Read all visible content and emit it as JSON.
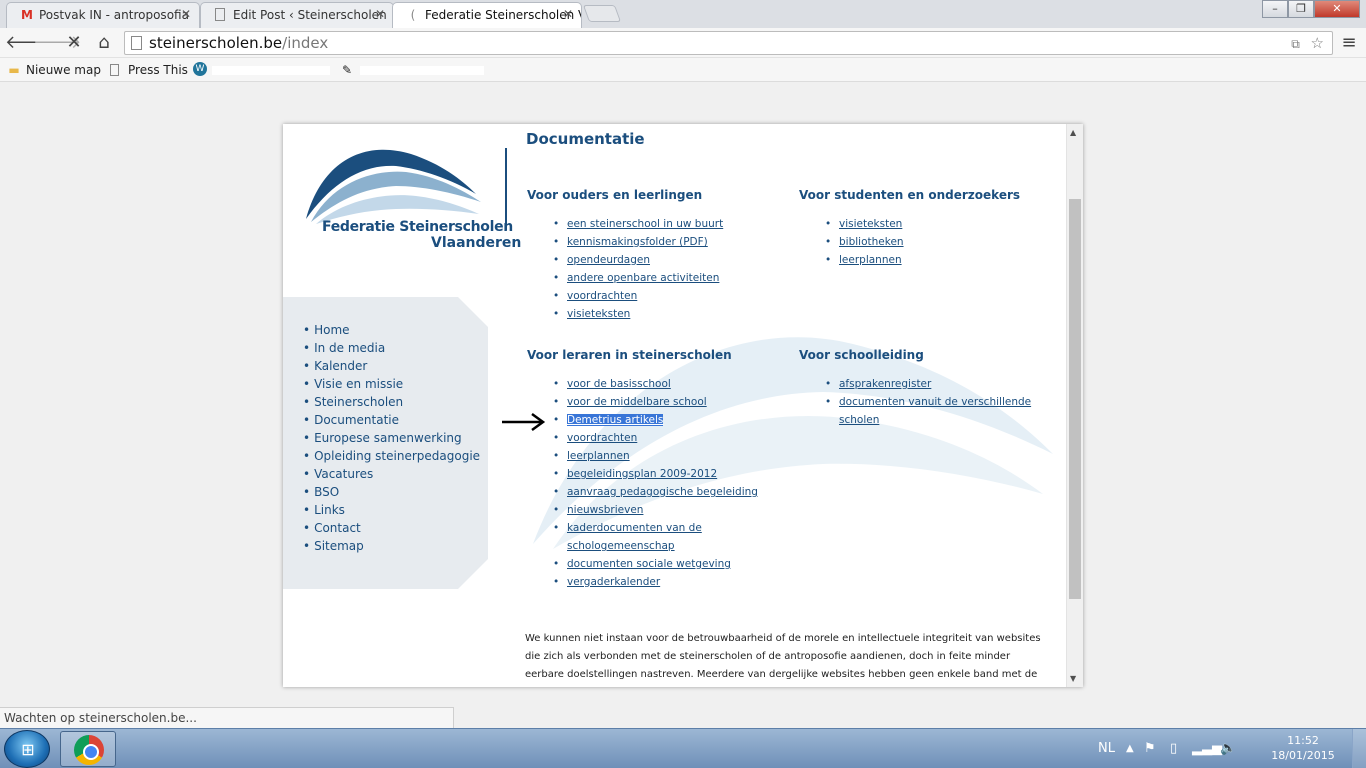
{
  "browser": {
    "tabs": [
      {
        "title": "Postvak IN - antroposofia",
        "icon": "gmail-icon"
      },
      {
        "title": "Edit Post ‹ Steinerscholen",
        "icon": "page-icon"
      },
      {
        "title": "Federatie Steinerscholen V",
        "icon": "loading-icon"
      }
    ],
    "url_host": "steinerscholen.be",
    "url_path": "/index",
    "bookmarks": [
      {
        "label": "Nieuwe map",
        "icon": "folder-icon"
      },
      {
        "label": "Press This",
        "icon": "page-icon"
      }
    ],
    "status_text": "Wachten op steinerscholen.be..."
  },
  "site": {
    "logo_line1": "Federatie Steinerscholen",
    "logo_line2": "Vlaanderen",
    "nav": [
      "Home",
      "In de media",
      "Kalender",
      "Visie en missie",
      "Steinerscholen",
      "Documentatie",
      "Europese samenwerking",
      "Opleiding steinerpedagogie",
      "Vacatures",
      "BSO",
      "Links",
      "Contact",
      "Sitemap"
    ],
    "page_title": "Documentatie",
    "sections": {
      "ouders": {
        "heading": "Voor ouders en leerlingen",
        "links": [
          "een steinerschool in uw buurt",
          "kennismakingsfolder (PDF)",
          "opendeurdagen",
          "andere openbare activiteiten",
          "voordrachten",
          "visieteksten"
        ]
      },
      "studenten": {
        "heading": "Voor studenten en onderzoekers",
        "links": [
          "visieteksten",
          "bibliotheken",
          "leerplannen"
        ]
      },
      "leraren": {
        "heading": "Voor leraren in steinerscholen",
        "links": [
          "voor de basisschool",
          "voor de middelbare school",
          "Demetrius artikels",
          "voordrachten",
          "leerplannen",
          "begeleidingsplan 2009-2012",
          "aanvraag pedagogische begeleiding",
          "nieuwsbrieven",
          "kaderdocumenten van de",
          "schologemeenschap",
          "documenten sociale wetgeving",
          "vergaderkalender"
        ]
      },
      "schoolleiding": {
        "heading": "Voor schoolleiding",
        "links": [
          "afsprakenregister",
          "documenten vanuit de verschillende",
          "scholen"
        ]
      }
    },
    "disclaimer": "We kunnen niet instaan voor de betrouwbaarheid of de morele en intellectuele integriteit van websites die zich als verbonden met de steinerscholen of de antroposofie aandienen, doch in feite minder eerbare doelstellingen nastreven. Meerdere van dergelijke websites hebben geen enkele band met de"
  },
  "taskbar": {
    "language": "NL",
    "time": "11:52",
    "date": "18/01/2015"
  }
}
